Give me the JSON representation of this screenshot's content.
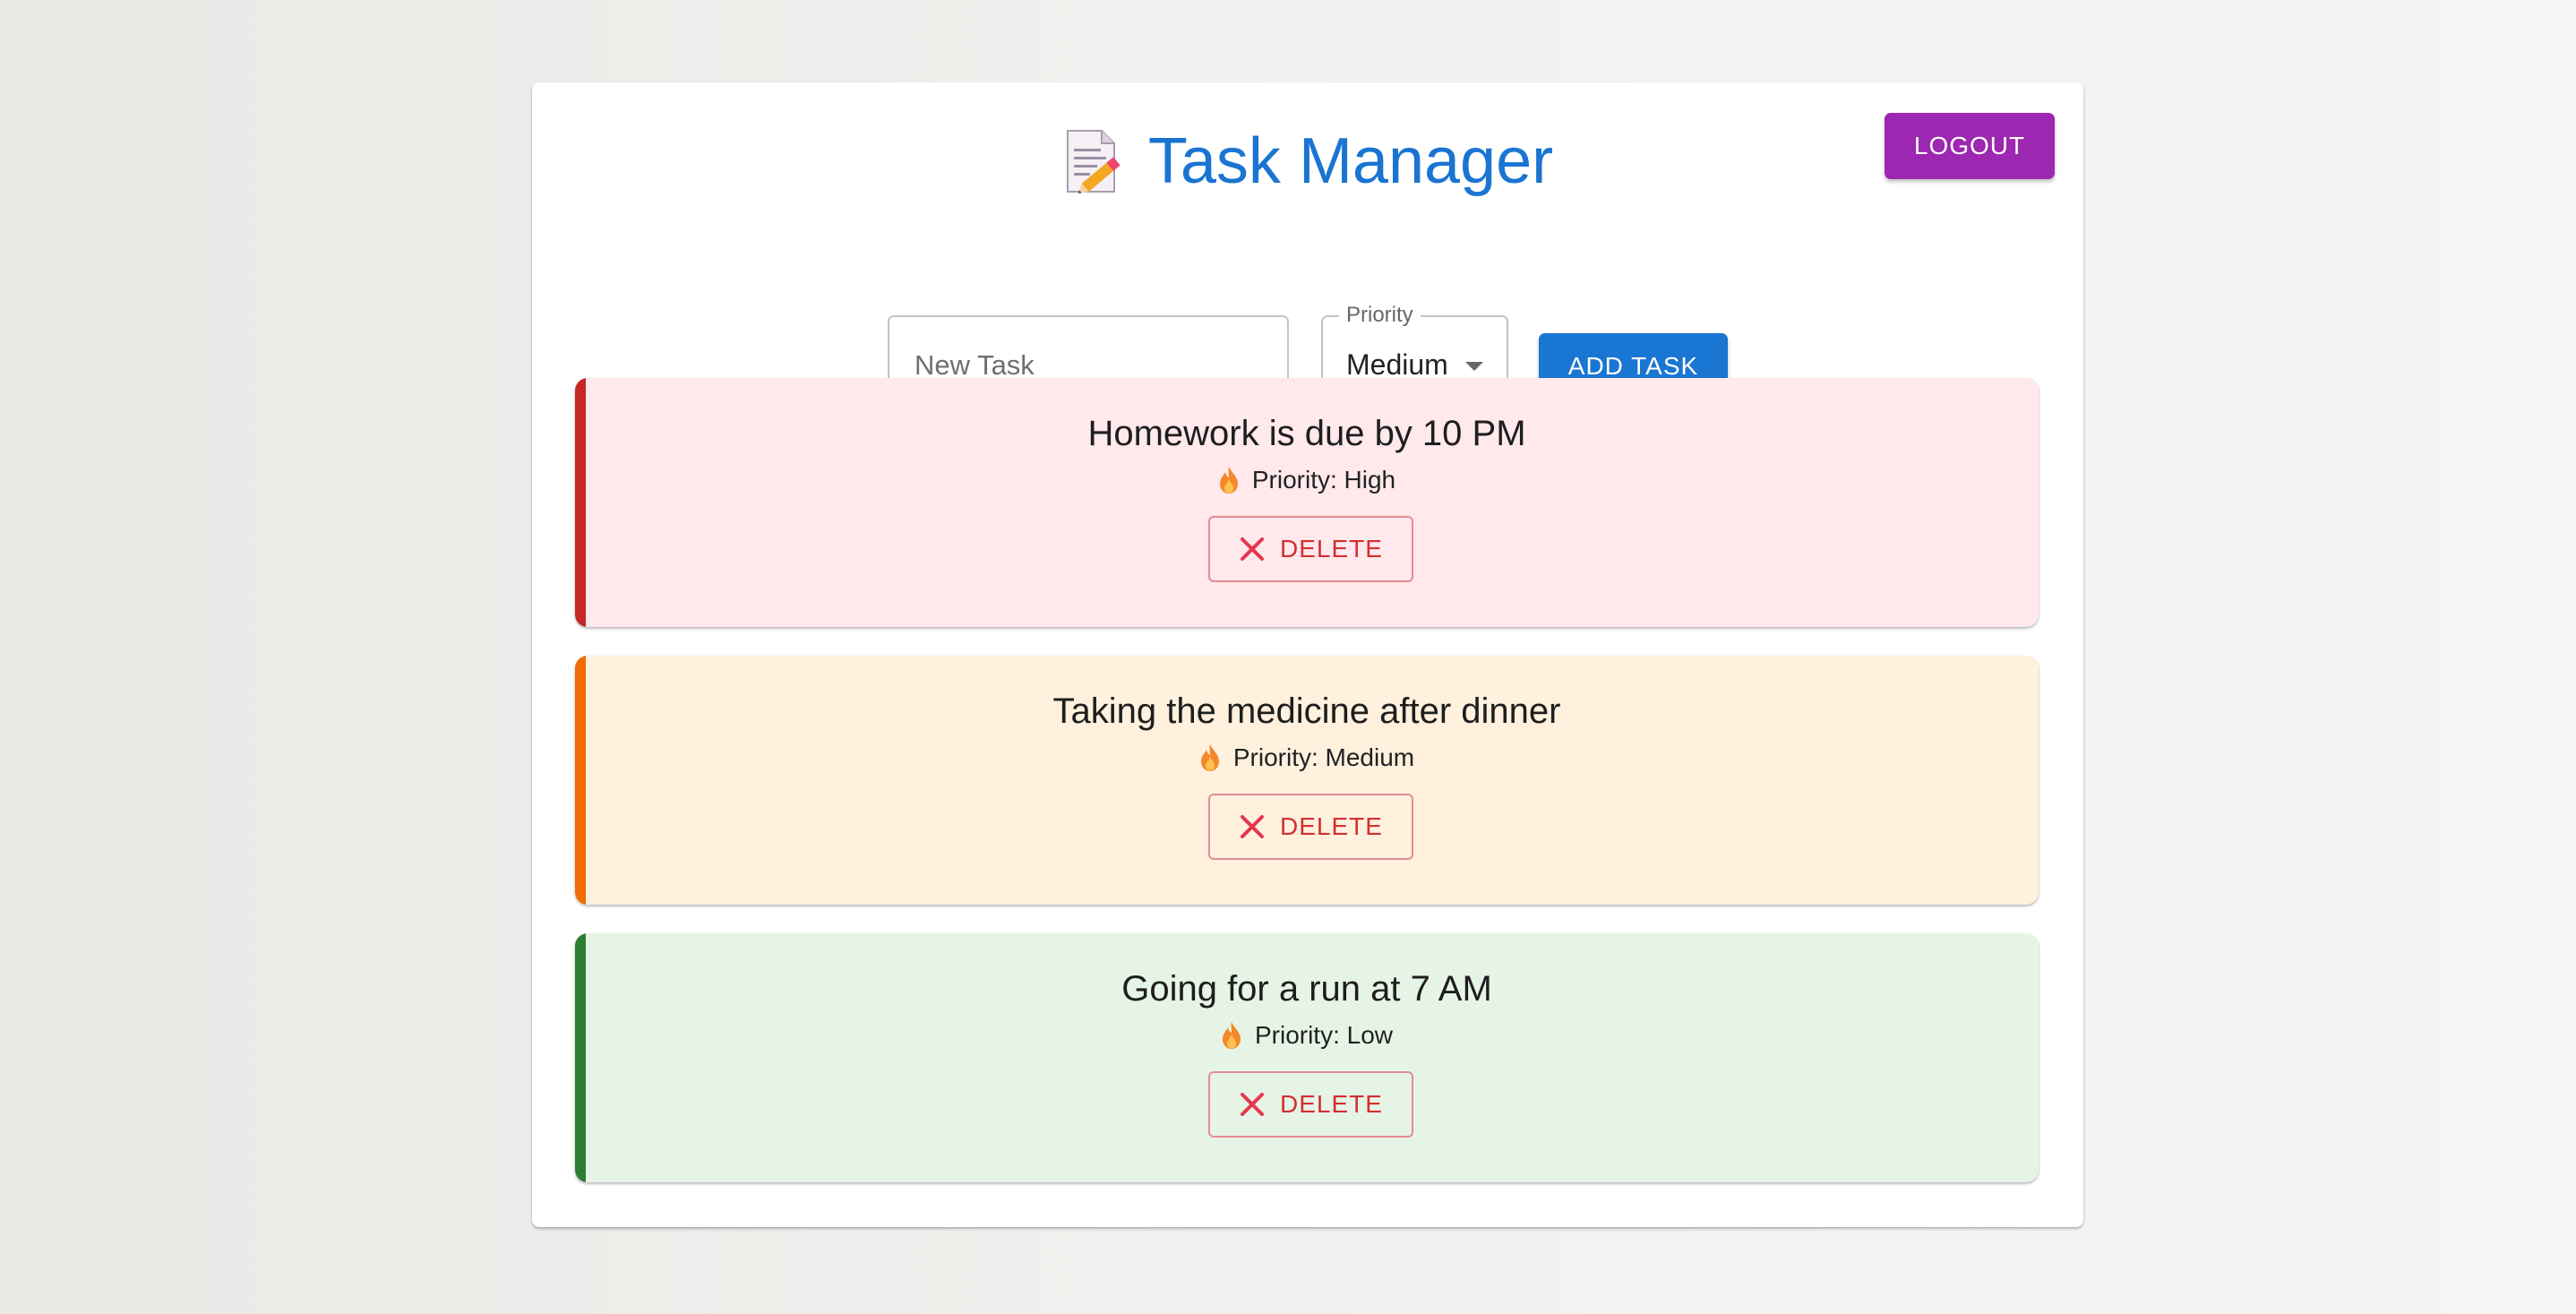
{
  "header": {
    "title": "Task Manager",
    "logout_label": "LOGOUT",
    "title_icon": "memo-icon"
  },
  "form": {
    "task_placeholder": "New Task",
    "task_value": "",
    "priority_label": "Priority",
    "priority_value": "Medium",
    "add_label": "ADD TASK"
  },
  "tasks": [
    {
      "title": "Homework is due by 10 PM",
      "priority_text": "Priority: High",
      "delete_label": "DELETE",
      "accent": "#c62828",
      "background": "#ffe9ec"
    },
    {
      "title": "Taking the medicine after dinner",
      "priority_text": "Priority: Medium",
      "delete_label": "DELETE",
      "accent": "#ef6c00",
      "background": "#fff1de"
    },
    {
      "title": "Going for a run at 7 AM",
      "priority_text": "Priority: Low",
      "delete_label": "DELETE",
      "accent": "#2e7d32",
      "background": "#e6f4e6"
    }
  ],
  "colors": {
    "title": "#1a74d2",
    "logout_button": "#9c27b0",
    "add_button": "#1976d2",
    "delete": "#d32f2f"
  }
}
